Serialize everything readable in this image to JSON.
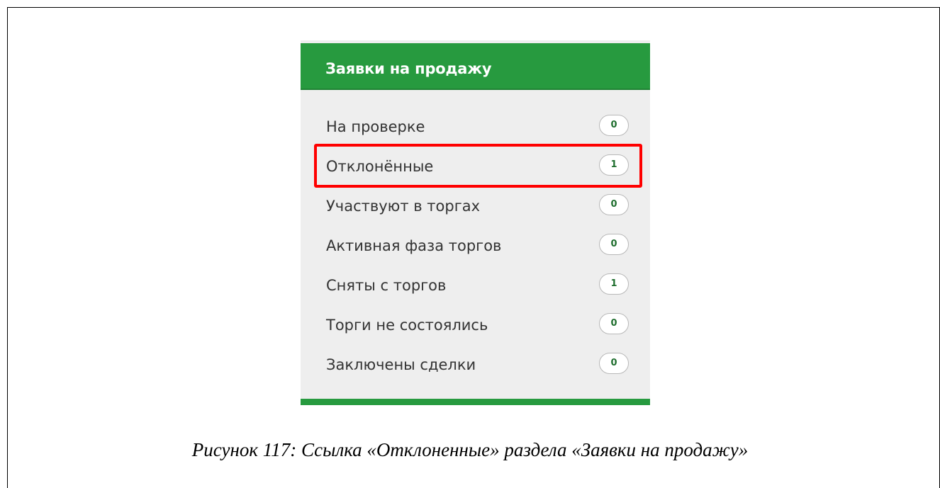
{
  "panel": {
    "title": "Заявки на продажу",
    "items": [
      {
        "label": "На проверке",
        "count": "0"
      },
      {
        "label": "Отклонённые",
        "count": "1"
      },
      {
        "label": "Участвуют в торгах",
        "count": "0"
      },
      {
        "label": "Активная фаза торгов",
        "count": "0"
      },
      {
        "label": "Сняты с торгов",
        "count": "1"
      },
      {
        "label": "Торги не состоялись",
        "count": "0"
      },
      {
        "label": "Заключены сделки",
        "count": "0"
      }
    ]
  },
  "caption": "Рисунок 117: Ссылка «Отклоненные» раздела «Заявки на продажу»",
  "colors": {
    "header": "#279a3f",
    "highlight": "#ff0000",
    "badge_text": "#1f6e2e"
  }
}
